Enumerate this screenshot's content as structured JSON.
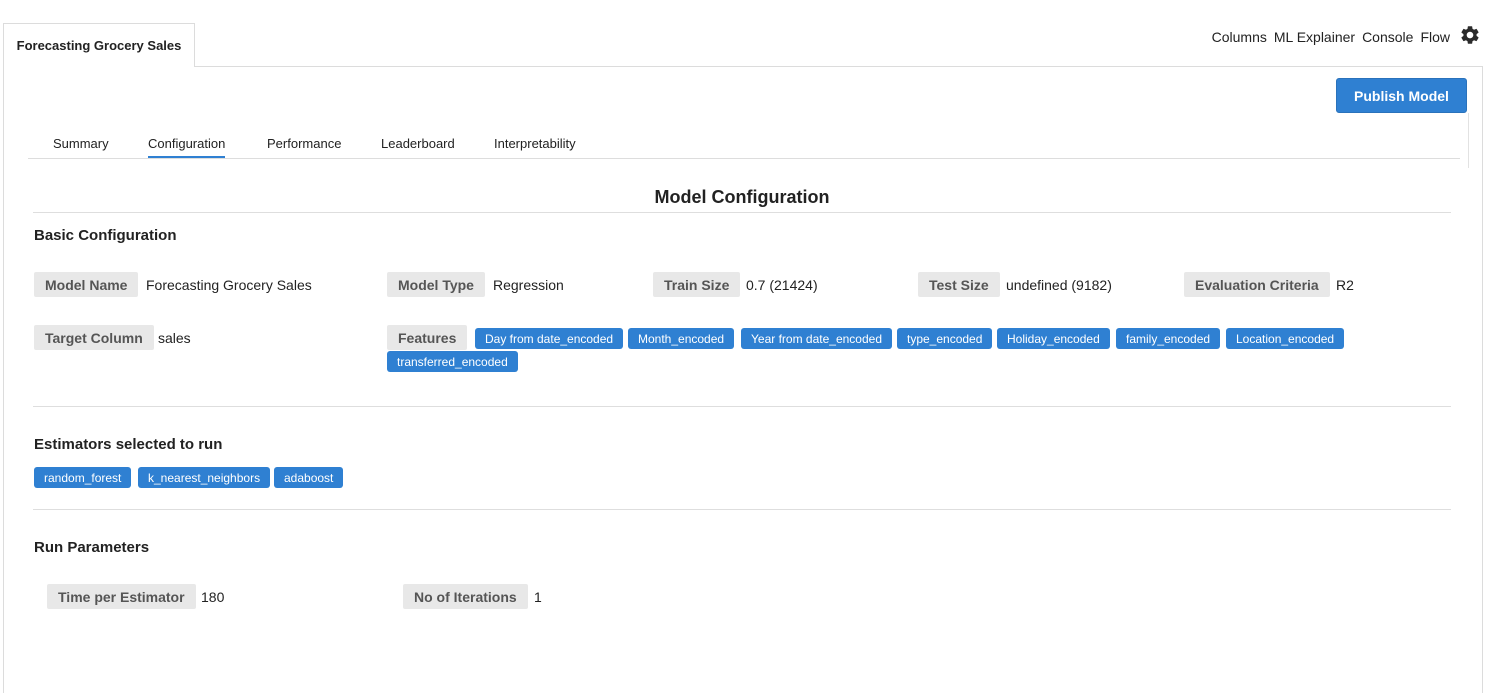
{
  "header": {
    "tab_title": "Forecasting Grocery Sales",
    "links": [
      "Columns",
      "ML Explainer",
      "Console",
      "Flow"
    ],
    "settings_icon": "gear-icon"
  },
  "toolbar": {
    "publish_label": "Publish Model"
  },
  "tabs": [
    {
      "label": "Summary",
      "active": false
    },
    {
      "label": "Configuration",
      "active": true
    },
    {
      "label": "Performance",
      "active": false
    },
    {
      "label": "Leaderboard",
      "active": false
    },
    {
      "label": "Interpretability",
      "active": false
    }
  ],
  "page_title": "Model Configuration",
  "basic": {
    "title": "Basic Configuration",
    "model_name_label": "Model Name",
    "model_name": "Forecasting Grocery Sales",
    "model_type_label": "Model Type",
    "model_type": "Regression",
    "train_size_label": "Train Size",
    "train_size": "0.7 (21424)",
    "test_size_label": "Test Size",
    "test_size": "undefined (9182)",
    "eval_label": "Evaluation Criteria",
    "eval": "R2",
    "target_label": "Target Column",
    "target": "sales",
    "features_label": "Features",
    "features": [
      "Day from date_encoded",
      "Month_encoded",
      "Year from date_encoded",
      "type_encoded",
      "Holiday_encoded",
      "family_encoded",
      "Location_encoded",
      "transferred_encoded"
    ]
  },
  "estimators": {
    "title": "Estimators selected to run",
    "items": [
      "random_forest",
      "k_nearest_neighbors",
      "adaboost"
    ]
  },
  "run_params": {
    "title": "Run Parameters",
    "time_label": "Time per Estimator",
    "time": "180",
    "iter_label": "No of Iterations",
    "iter": "1"
  },
  "colors": {
    "accent": "#2f80d2",
    "label_bg": "#e8e8e8"
  }
}
